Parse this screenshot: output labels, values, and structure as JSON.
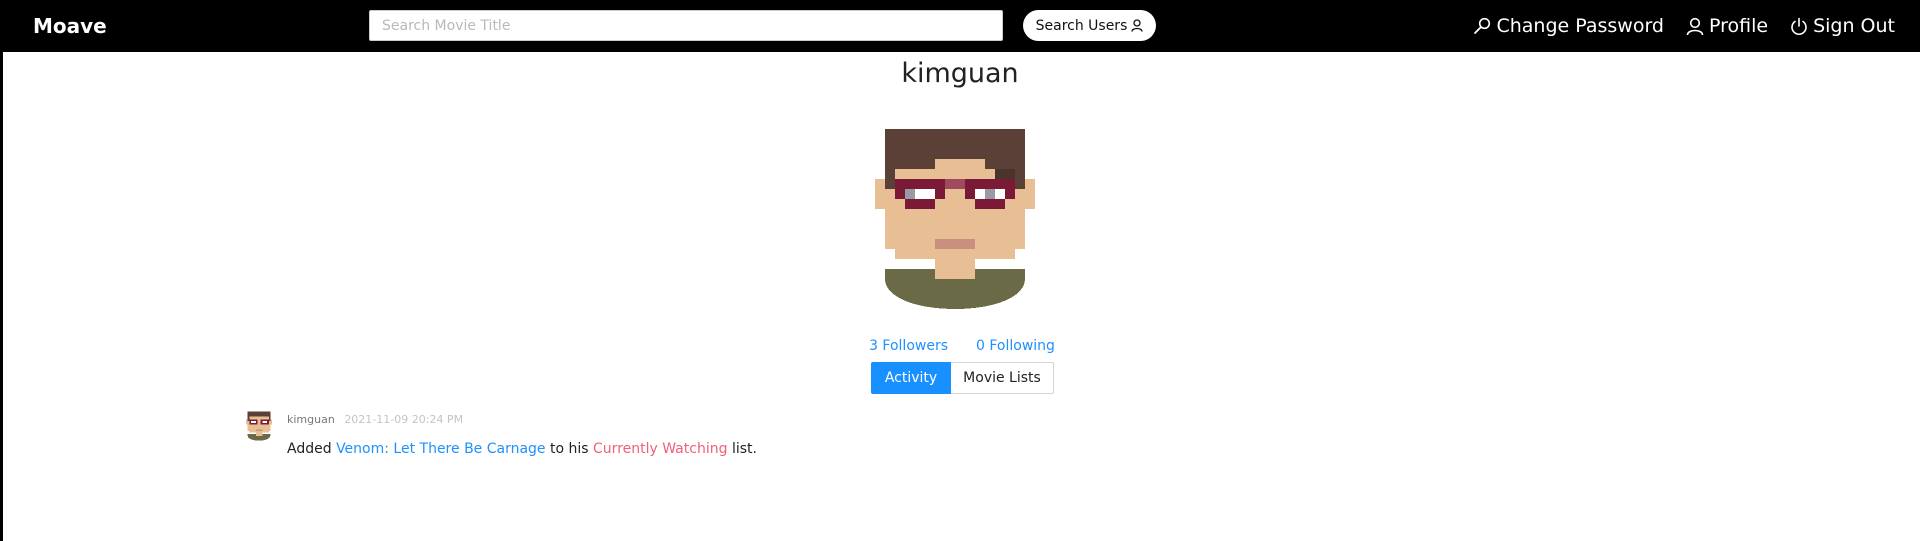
{
  "navbar": {
    "brand": "Moave",
    "search_placeholder": "Search Movie Title",
    "search_users_label": "Search Users",
    "change_password_label": "Change Password",
    "profile_label": "Profile",
    "sign_out_label": "Sign Out"
  },
  "profile": {
    "username": "kimguan",
    "followers_label": "3 Followers",
    "following_label": "0 Following",
    "tabs": [
      {
        "label": "Activity",
        "active": true
      },
      {
        "label": "Movie Lists",
        "active": false
      }
    ]
  },
  "activity": [
    {
      "user": "kimguan",
      "timestamp": "2021-11-09 20:24 PM",
      "prefix": "Added",
      "movie": "Venom: Let There Be Carnage",
      "middle": "to his",
      "list_name": "Currently Watching",
      "suffix": "list."
    }
  ],
  "colors": {
    "navbar_bg": "#000000",
    "accent_blue": "#1890ff",
    "link_pink": "#f0607a",
    "avatar_skin": "#e8bf95",
    "avatar_hair": "#5b4038",
    "avatar_glasses": "#7a1a36",
    "avatar_shirt": "#6a6a47"
  },
  "icons": {
    "search_users": "user-icon",
    "change_password": "key-icon",
    "profile": "user-icon",
    "sign_out": "power-icon"
  }
}
